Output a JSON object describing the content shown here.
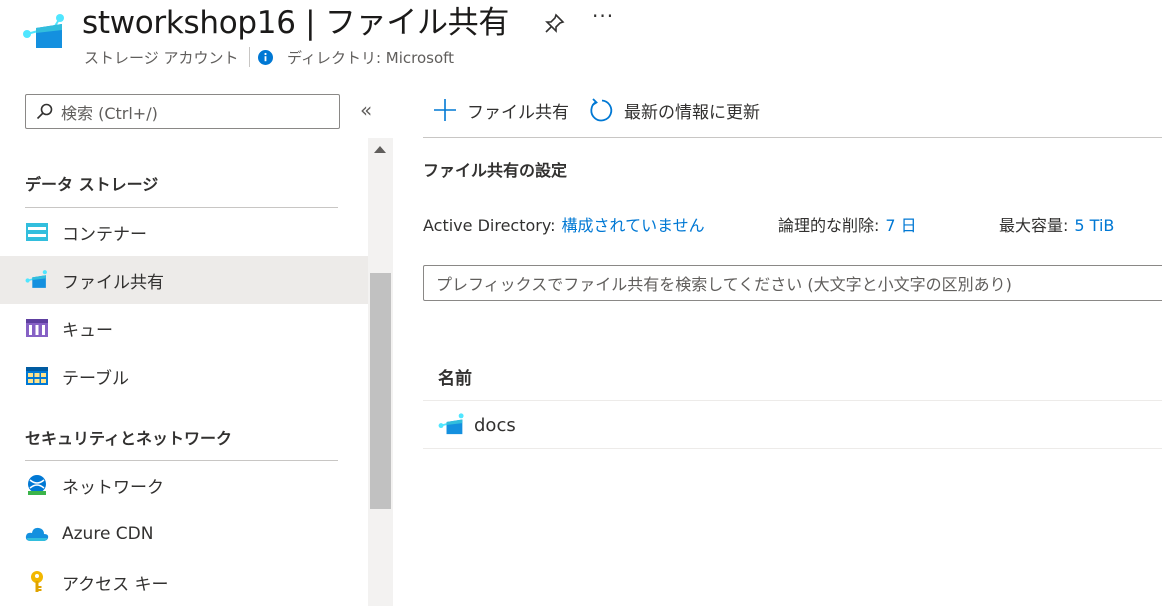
{
  "header": {
    "title": "stworkshop16 | ファイル共有",
    "subtitle": "ストレージ アカウント",
    "directory": "ディレクトリ: Microsoft",
    "more": "···"
  },
  "sidebar": {
    "search_placeholder": "検索 (Ctrl+/)",
    "collapse": "«",
    "sections": [
      {
        "title": "データ ストレージ",
        "items": [
          {
            "label": "コンテナー",
            "icon": "container-icon"
          },
          {
            "label": "ファイル共有",
            "icon": "file-share-icon",
            "active": true
          },
          {
            "label": "キュー",
            "icon": "queue-icon"
          },
          {
            "label": "テーブル",
            "icon": "table-icon"
          }
        ]
      },
      {
        "title": "セキュリティとネットワーク",
        "items": [
          {
            "label": "ネットワーク",
            "icon": "network-icon"
          },
          {
            "label": "Azure CDN",
            "icon": "cloud-icon"
          },
          {
            "label": "アクセス キー",
            "icon": "key-icon"
          }
        ]
      }
    ]
  },
  "toolbar": {
    "add_label": "ファイル共有",
    "refresh_label": "最新の情報に更新"
  },
  "settings": {
    "title": "ファイル共有の設定",
    "ad_key": "Active Directory:",
    "ad_value": "構成されていません",
    "softdelete_key": "論理的な削除:",
    "softdelete_value": "7 日",
    "capacity_key": "最大容量:",
    "capacity_value": "5 TiB"
  },
  "filter": {
    "placeholder": "プレフィックスでファイル共有を検索してください (大文字と小文字の区別あり)"
  },
  "table": {
    "columns": [
      "名前"
    ],
    "rows": [
      {
        "name": "docs"
      }
    ]
  },
  "colors": {
    "accent": "#0078d4",
    "active_bg": "#edebe9"
  }
}
